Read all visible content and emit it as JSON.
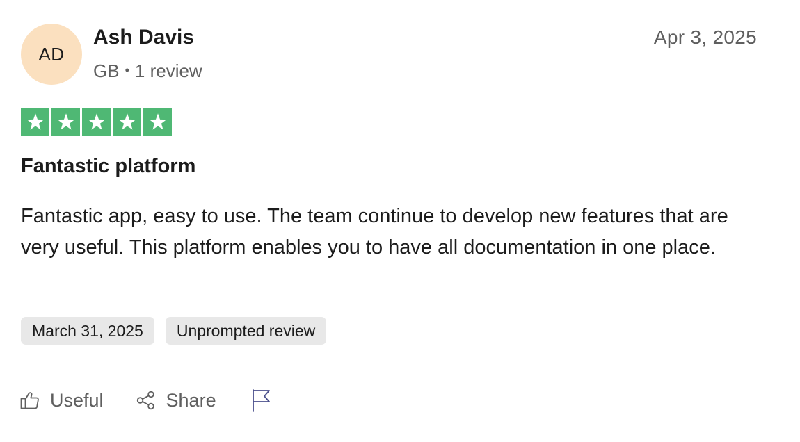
{
  "review": {
    "avatar_initials": "AD",
    "avatar_color": "#fbe0bf",
    "author_name": "Ash Davis",
    "country": "GB",
    "separator": "•",
    "review_count": "1 review",
    "date_posted": "Apr 3, 2025",
    "rating": 5,
    "rating_max": 5,
    "star_color": "#4fb874",
    "title": "Fantastic platform",
    "body": "Fantastic app, easy to use. The team continue to develop new features that are very useful. This platform enables you to have all documentation in one place.",
    "experience_date": "March 31, 2025",
    "review_type": "Unprompted review"
  },
  "actions": {
    "useful_label": "Useful",
    "useful_icon": "thumbs-up-icon",
    "share_label": "Share",
    "share_icon": "share-icon",
    "report_icon": "flag-icon"
  }
}
